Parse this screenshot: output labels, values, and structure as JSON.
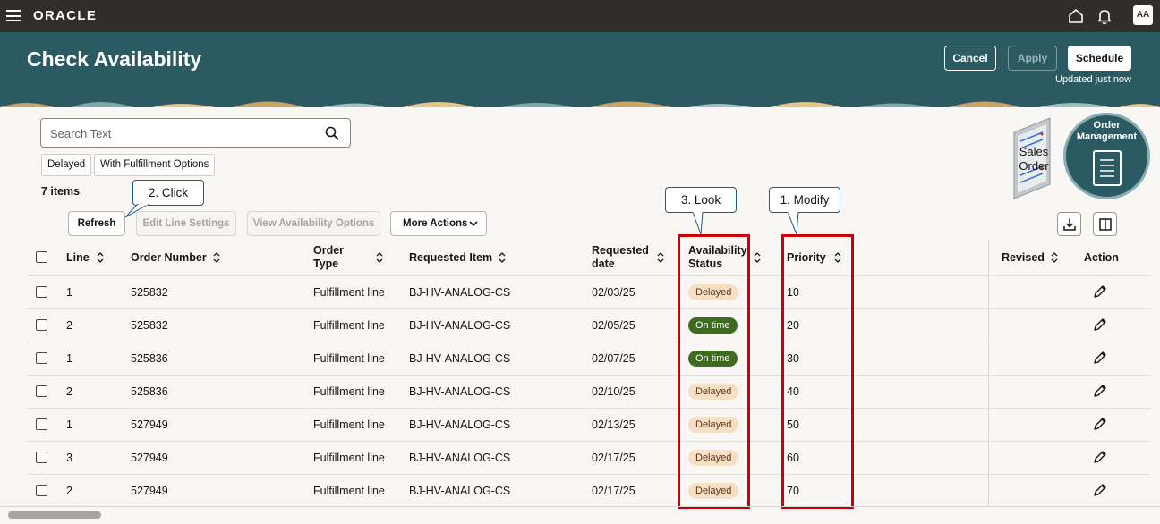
{
  "topbar": {
    "brand": "ORACLE",
    "avatar": "AA"
  },
  "header": {
    "title": "Check Availability",
    "cancel_label": "Cancel",
    "apply_label": "Apply",
    "schedule_label": "Schedule",
    "updated_text": "Updated just now"
  },
  "search": {
    "placeholder": "Search Text"
  },
  "filters": [
    "Delayed",
    "With Fulfillment Options"
  ],
  "items_count": "7 items",
  "toolbar": {
    "refresh": "Refresh",
    "edit_line_settings": "Edit Line Settings",
    "view_availability_options": "View Availability Options",
    "more_actions": "More Actions"
  },
  "callouts": {
    "click": "2. Click",
    "look": "3. Look",
    "modify": "1. Modify"
  },
  "graphics": {
    "sales_order": "Sales Order",
    "order_management": "Order Management"
  },
  "table": {
    "headers": {
      "line": "Line",
      "order_number": "Order Number",
      "order_type": "Order Type",
      "requested_item": "Requested Item",
      "requested_date": "Requested date",
      "availability_status": "Availability Status",
      "priority": "Priority",
      "revised": "Revised",
      "action": "Action"
    },
    "rows": [
      {
        "line": "1",
        "order_number": "525832",
        "order_type": "Fulfillment line",
        "item": "BJ-HV-ANALOG-CS",
        "date": "02/03/25",
        "status": "Delayed",
        "priority": "10"
      },
      {
        "line": "2",
        "order_number": "525832",
        "order_type": "Fulfillment line",
        "item": "BJ-HV-ANALOG-CS",
        "date": "02/05/25",
        "status": "On time",
        "priority": "20"
      },
      {
        "line": "1",
        "order_number": "525836",
        "order_type": "Fulfillment line",
        "item": "BJ-HV-ANALOG-CS",
        "date": "02/07/25",
        "status": "On time",
        "priority": "30"
      },
      {
        "line": "2",
        "order_number": "525836",
        "order_type": "Fulfillment line",
        "item": "BJ-HV-ANALOG-CS",
        "date": "02/10/25",
        "status": "Delayed",
        "priority": "40"
      },
      {
        "line": "1",
        "order_number": "527949",
        "order_type": "Fulfillment line",
        "item": "BJ-HV-ANALOG-CS",
        "date": "02/13/25",
        "status": "Delayed",
        "priority": "50"
      },
      {
        "line": "3",
        "order_number": "527949",
        "order_type": "Fulfillment line",
        "item": "BJ-HV-ANALOG-CS",
        "date": "02/17/25",
        "status": "Delayed",
        "priority": "60"
      },
      {
        "line": "2",
        "order_number": "527949",
        "order_type": "Fulfillment line",
        "item": "BJ-HV-ANALOG-CS",
        "date": "02/17/25",
        "status": "Delayed",
        "priority": "70"
      }
    ]
  },
  "colors": {
    "header_bg": "#2b5a63",
    "topbar_bg": "#312d2a",
    "delayed_badge": "#f6dfc2",
    "ontime_badge": "#3e6c1e",
    "highlight_box": "#c9000a"
  }
}
